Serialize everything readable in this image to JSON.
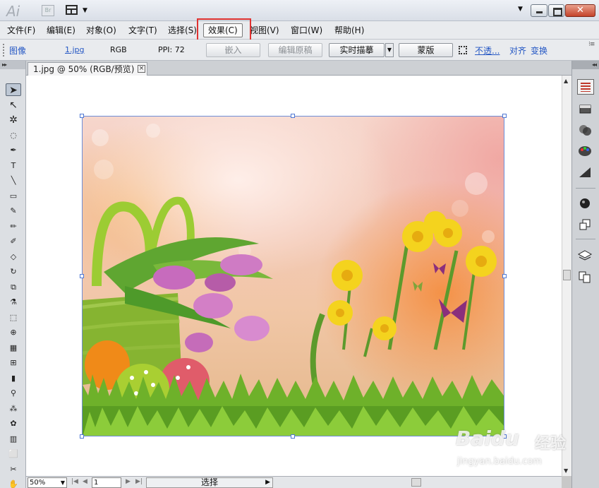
{
  "app": {
    "logo": "Ai",
    "bridge_label": "Br"
  },
  "menubar": {
    "items": [
      {
        "label": "文件(F)"
      },
      {
        "label": "编辑(E)"
      },
      {
        "label": "对象(O)"
      },
      {
        "label": "文字(T)"
      },
      {
        "label": "选择(S)"
      },
      {
        "label": "效果(C)",
        "active": true
      },
      {
        "label": "视图(V)"
      },
      {
        "label": "窗口(W)"
      },
      {
        "label": "帮助(H)"
      }
    ],
    "highlight_color": "#e03331"
  },
  "controlbar": {
    "object_type": "图像",
    "filename": "1.jpg",
    "color_mode": "RGB",
    "ppi": "PPI: 72",
    "embed_button": "嵌入",
    "edit_original_button": "编辑原稿",
    "live_trace_button": "实时描摹",
    "mask_button": "蒙版",
    "opacity_link": "不透...",
    "align_link": "对齐",
    "transform_link": "变换"
  },
  "document": {
    "tab_title": "1.jpg @ 50% (RGB/预览)",
    "close_glyph": "×"
  },
  "statusbar": {
    "zoom": "50%",
    "page": "1",
    "selection_tool_label": "选择"
  },
  "watermark": {
    "logo": "Baidu",
    "cn": "经验",
    "url": "jingyan.baidu.com"
  },
  "toolbox": {
    "tools": [
      {
        "name": "selection-tool-icon",
        "glyph": "➤"
      },
      {
        "name": "direct-selection-tool-icon",
        "glyph": "↖"
      },
      {
        "name": "magic-wand-tool-icon",
        "glyph": "✲"
      },
      {
        "name": "lasso-tool-icon",
        "glyph": "◌"
      },
      {
        "name": "pen-tool-icon",
        "glyph": "✒"
      },
      {
        "name": "type-tool-icon",
        "glyph": "T"
      },
      {
        "name": "line-tool-icon",
        "glyph": "╲"
      },
      {
        "name": "rectangle-tool-icon",
        "glyph": "▭"
      },
      {
        "name": "paintbrush-tool-icon",
        "glyph": "✎"
      },
      {
        "name": "pencil-tool-icon",
        "glyph": "✏"
      },
      {
        "name": "blob-brush-tool-icon",
        "glyph": "✐"
      },
      {
        "name": "eraser-tool-icon",
        "glyph": "◇"
      },
      {
        "name": "rotate-tool-icon",
        "glyph": "↻"
      },
      {
        "name": "scale-tool-icon",
        "glyph": "⧉"
      },
      {
        "name": "warp-tool-icon",
        "glyph": "⚗"
      },
      {
        "name": "free-transform-tool-icon",
        "glyph": "⬚"
      },
      {
        "name": "shape-builder-tool-icon",
        "glyph": "⊕"
      },
      {
        "name": "perspective-grid-tool-icon",
        "glyph": "▦"
      },
      {
        "name": "mesh-tool-icon",
        "glyph": "⊞"
      },
      {
        "name": "gradient-tool-icon",
        "glyph": "▮"
      },
      {
        "name": "eyedropper-tool-icon",
        "glyph": "⚲"
      },
      {
        "name": "blend-tool-icon",
        "glyph": "⁂"
      },
      {
        "name": "symbol-sprayer-tool-icon",
        "glyph": "✿"
      },
      {
        "name": "column-graph-tool-icon",
        "glyph": "▥"
      },
      {
        "name": "artboard-tool-icon",
        "glyph": "⬜"
      },
      {
        "name": "slice-tool-icon",
        "glyph": "✂"
      },
      {
        "name": "hand-tool-icon",
        "glyph": "✋"
      }
    ]
  }
}
